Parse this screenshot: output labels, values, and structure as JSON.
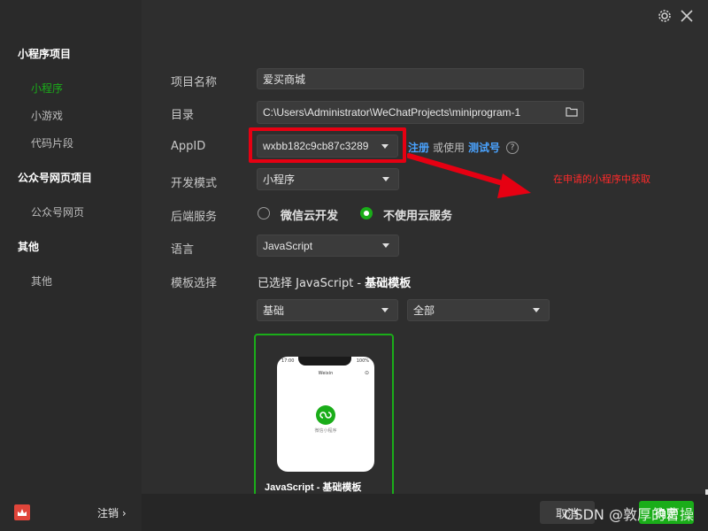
{
  "sidebar": {
    "groups": [
      {
        "label": "小程序项目",
        "items": [
          {
            "label": "小程序",
            "active": true
          },
          {
            "label": "小游戏"
          },
          {
            "label": "代码片段"
          }
        ]
      },
      {
        "label": "公众号网页项目",
        "items": [
          {
            "label": "公众号网页"
          }
        ]
      },
      {
        "label": "其他",
        "items": [
          {
            "label": "其他"
          }
        ]
      }
    ],
    "footer": {
      "logout_label": "注销 ›"
    }
  },
  "topbar": {
    "settings_icon": "gear-icon",
    "close_icon": "close-icon"
  },
  "form": {
    "project_name": {
      "label": "项目名称",
      "value": "爱买商城"
    },
    "directory": {
      "label": "目录",
      "value": "C:\\Users\\Administrator\\WeChatProjects\\miniprogram-1"
    },
    "appid": {
      "label": "AppID",
      "value": "wxbb182c9cb87c3289",
      "register_link": "注册",
      "or_use_text": "或使用",
      "test_link": "测试号",
      "help_icon": "?"
    },
    "dev_mode": {
      "label": "开发模式",
      "value": "小程序"
    },
    "backend": {
      "label": "后端服务",
      "options": [
        {
          "label": "微信云开发",
          "checked": false
        },
        {
          "label": "不使用云服务",
          "checked": true
        }
      ]
    },
    "language": {
      "label": "语言",
      "value": "JavaScript"
    },
    "template": {
      "label": "模板选择",
      "selected_prefix": "已选择 JavaScript -",
      "selected_name": "基础模板",
      "filter_category": "基础",
      "filter_scope": "全部",
      "card": {
        "title": "JavaScript - 基础模板",
        "phone_time": "17:00",
        "phone_battery": "100%",
        "phone_title": "Weixin",
        "phone_caption": "微信小程序"
      }
    }
  },
  "annotation": {
    "text": "在申请的小程序中获取",
    "color": "#ff2a2a"
  },
  "bottom": {
    "cancel_label": "取消",
    "ok_label": "确定"
  },
  "watermark": "CSDN @敦厚的曹操",
  "colors": {
    "accent": "#1aad19",
    "link": "#4aa3ff",
    "highlight": "#e60012"
  }
}
